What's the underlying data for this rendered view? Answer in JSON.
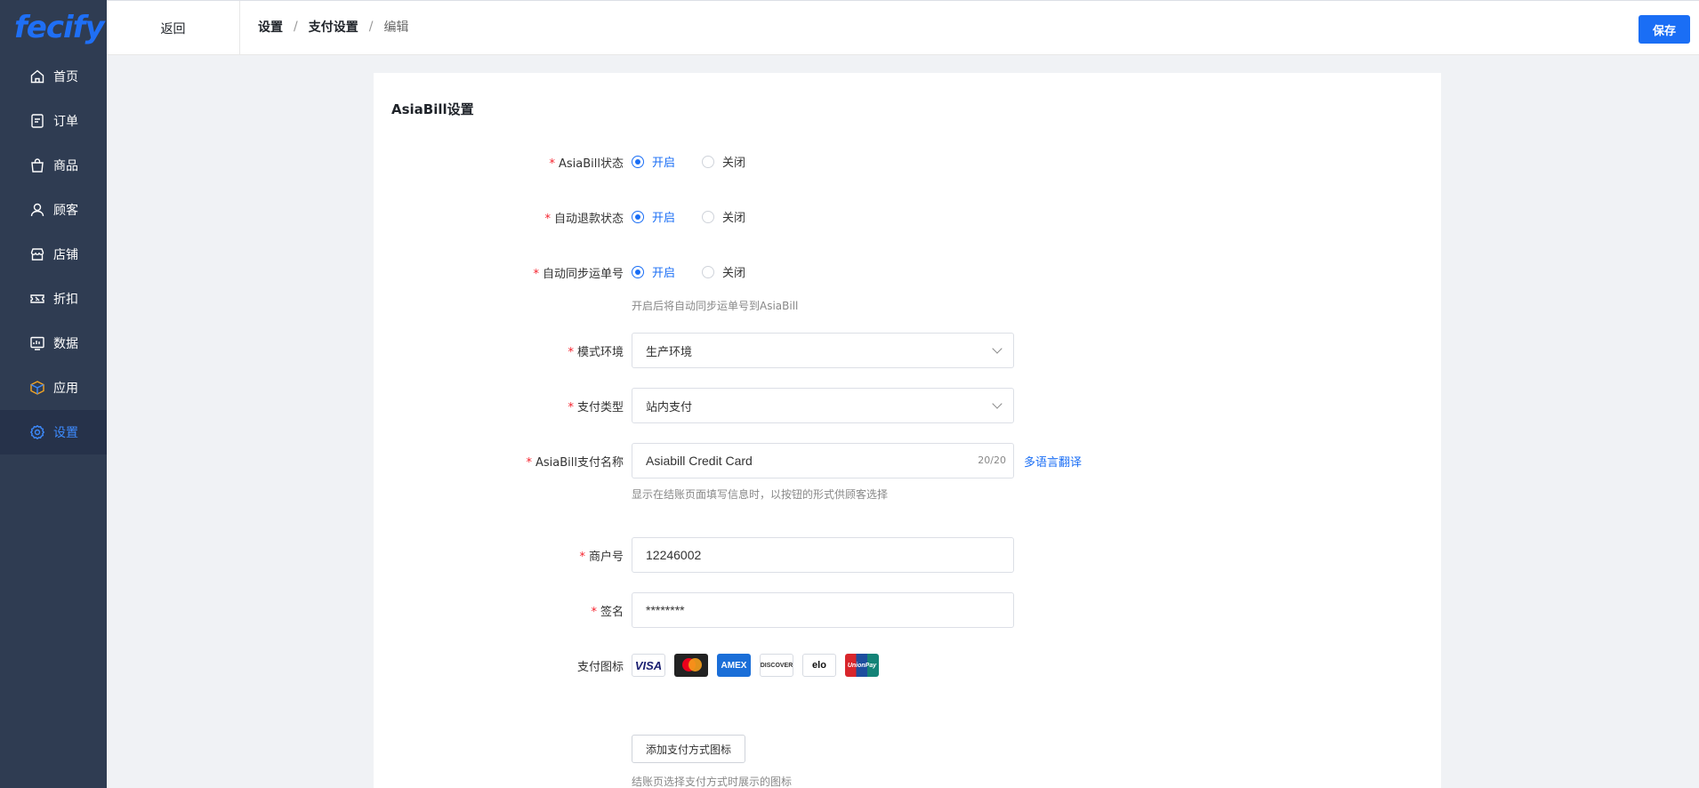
{
  "brand": {
    "logo_text": "fecify"
  },
  "sidebar": {
    "items": [
      {
        "label": "首页",
        "icon": "home-icon"
      },
      {
        "label": "订单",
        "icon": "order-icon"
      },
      {
        "label": "商品",
        "icon": "bag-icon"
      },
      {
        "label": "顾客",
        "icon": "user-icon"
      },
      {
        "label": "店铺",
        "icon": "store-icon"
      },
      {
        "label": "折扣",
        "icon": "ticket-icon"
      },
      {
        "label": "数据",
        "icon": "chart-icon"
      },
      {
        "label": "应用",
        "icon": "box-icon"
      },
      {
        "label": "设置",
        "icon": "gear-icon",
        "active": true
      }
    ]
  },
  "header": {
    "back_label": "返回",
    "breadcrumb": [
      "设置",
      "支付设置",
      "编辑"
    ],
    "save_label": "保存"
  },
  "form": {
    "title": "AsiaBill设置",
    "status": {
      "label": "AsiaBill状态",
      "on": "开启",
      "off": "关闭",
      "value": "开启"
    },
    "refund": {
      "label": "自动退款状态",
      "on": "开启",
      "off": "关闭",
      "value": "开启"
    },
    "sync": {
      "label": "自动同步运单号",
      "on": "开启",
      "off": "关闭",
      "value": "开启",
      "hint": "开启后将自动同步运单号到AsiaBill"
    },
    "env": {
      "label": "模式环境",
      "value": "生产环境"
    },
    "pay_type": {
      "label": "支付类型",
      "value": "站内支付"
    },
    "pay_name": {
      "label": "AsiaBill支付名称",
      "value": "Asiabill Credit Card",
      "count": "20/20",
      "multilang": "多语言翻译",
      "hint": "显示在结账页面填写信息时，以按钮的形式供顾客选择"
    },
    "merchant": {
      "label": "商户号",
      "value": "12246002"
    },
    "sign": {
      "label": "签名",
      "value": "********"
    },
    "pay_icons": {
      "label": "支付图标",
      "icons": [
        "VISA",
        "MasterCard",
        "AMEX",
        "DISCOVER",
        "elo",
        "UnionPay"
      ],
      "add_label": "添加支付方式图标",
      "hint": "结账页选择支付方式时展示的图标"
    }
  },
  "colors": {
    "accent": "#1a6ef5",
    "sidebar_bg": "#2f3c52",
    "required": "#f5222d"
  }
}
